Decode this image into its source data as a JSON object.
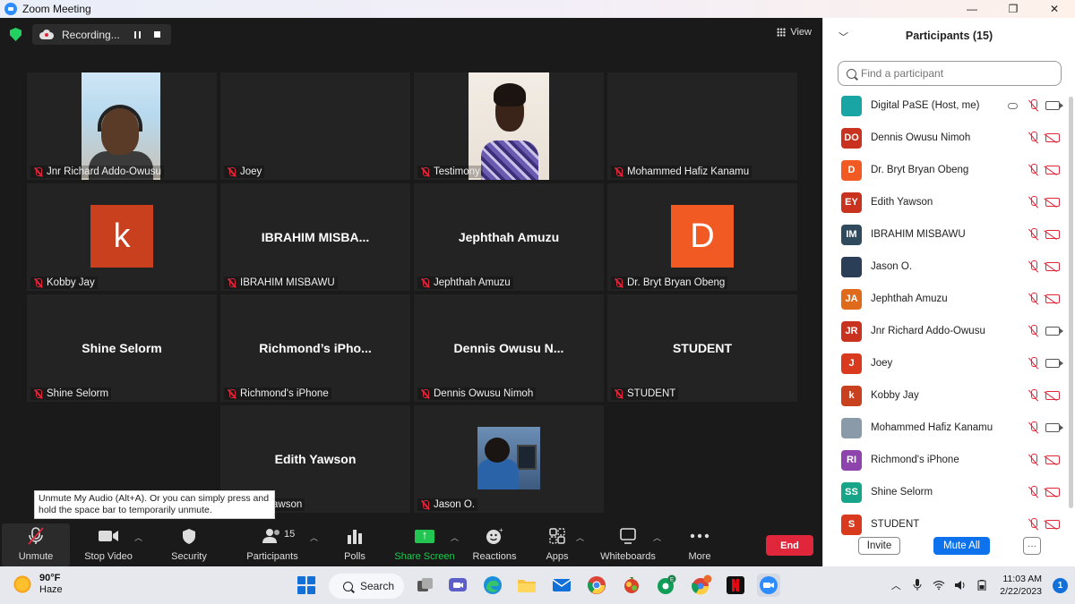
{
  "window": {
    "title": "Zoom Meeting",
    "minimize": "—",
    "maximize": "❐",
    "close": "✕"
  },
  "recording": {
    "label": "Recording..."
  },
  "view": {
    "label": "View"
  },
  "tiles": [
    {
      "name": "Jnr Richard Addo-Owusu",
      "center": "",
      "video": "photo1"
    },
    {
      "name": "Joey",
      "center": "",
      "video": "none"
    },
    {
      "name": "Testimony",
      "center": "",
      "video": "photo2"
    },
    {
      "name": "Mohammed Hafiz Kanamu",
      "center": "",
      "video": "none"
    },
    {
      "name": "Kobby Jay",
      "center": "",
      "avatar_letter": "k",
      "avatar_color": "#c8401e"
    },
    {
      "name": "IBRAHIM MISBAWU",
      "center": "IBRAHIM  MISBA..."
    },
    {
      "name": "Jephthah Amuzu",
      "center": "Jephthah Amuzu"
    },
    {
      "name": "Dr. Bryt Bryan Obeng",
      "center": "",
      "avatar_letter": "D",
      "avatar_color": "#f15a22"
    },
    {
      "name": "Shine Selorm",
      "center": "Shine Selorm"
    },
    {
      "name": "Richmond's iPhone",
      "center": "Richmond’s  iPho..."
    },
    {
      "name": "Dennis Owusu Nimoh",
      "center": "Dennis  Owusu  N..."
    },
    {
      "name": "STUDENT",
      "center": "STUDENT"
    },
    {
      "name": "Edith Yawson",
      "center": "Edith Yawson"
    },
    {
      "name": "Jason O.",
      "center": "",
      "video": "photo3"
    }
  ],
  "tooltip": {
    "text": "Unmute My Audio (Alt+A). Or you can simply press and hold the space bar to temporarily unmute."
  },
  "toolbar": {
    "unmute": "Unmute",
    "stop_video": "Stop Video",
    "security": "Security",
    "participants": "Participants",
    "participants_count": "15",
    "polls": "Polls",
    "share_screen": "Share Screen",
    "reactions": "Reactions",
    "apps": "Apps",
    "whiteboards": "Whiteboards",
    "more": "More",
    "end": "End"
  },
  "panel": {
    "title": "Participants (15)",
    "search_placeholder": "Find a participant",
    "invite": "Invite",
    "mute_all": "Mute All",
    "more": "···",
    "participants": [
      {
        "initials": "",
        "name": "Digital PaSE (Host, me)",
        "color": "#1aa5a5",
        "video_on": true,
        "host": true
      },
      {
        "initials": "DO",
        "name": "Dennis Owusu Nimoh",
        "color": "#c8321e",
        "video_on": false
      },
      {
        "initials": "D",
        "name": "Dr. Bryt Bryan Obeng",
        "color": "#f15a22",
        "video_on": false
      },
      {
        "initials": "EY",
        "name": "Edith Yawson",
        "color": "#c8321e",
        "video_on": false
      },
      {
        "initials": "IM",
        "name": "IBRAHIM MISBAWU",
        "color": "#2f4a5c",
        "video_on": false
      },
      {
        "initials": "",
        "name": "Jason O.",
        "color": "#2b3e57",
        "video_on": false
      },
      {
        "initials": "JA",
        "name": "Jephthah Amuzu",
        "color": "#e06a1b",
        "video_on": false
      },
      {
        "initials": "JR",
        "name": "Jnr Richard Addo-Owusu",
        "color": "#c8321e",
        "video_on": true
      },
      {
        "initials": "J",
        "name": "Joey",
        "color": "#d93a1e",
        "video_on": true
      },
      {
        "initials": "k",
        "name": "Kobby Jay",
        "color": "#c8401e",
        "video_on": false
      },
      {
        "initials": "",
        "name": "Mohammed Hafiz Kanamu",
        "color": "#8a9aa8",
        "video_on": true
      },
      {
        "initials": "RI",
        "name": "Richmond's iPhone",
        "color": "#8e44ad",
        "video_on": false
      },
      {
        "initials": "SS",
        "name": "Shine Selorm",
        "color": "#17a589",
        "video_on": false
      },
      {
        "initials": "S",
        "name": "STUDENT",
        "color": "#d93a1e",
        "video_on": false
      }
    ]
  },
  "taskbar": {
    "weather_temp": "90°F",
    "weather_desc": "Haze",
    "search": "Search",
    "time": "11:03 AM",
    "date": "2/22/2023",
    "notifications": "1"
  }
}
